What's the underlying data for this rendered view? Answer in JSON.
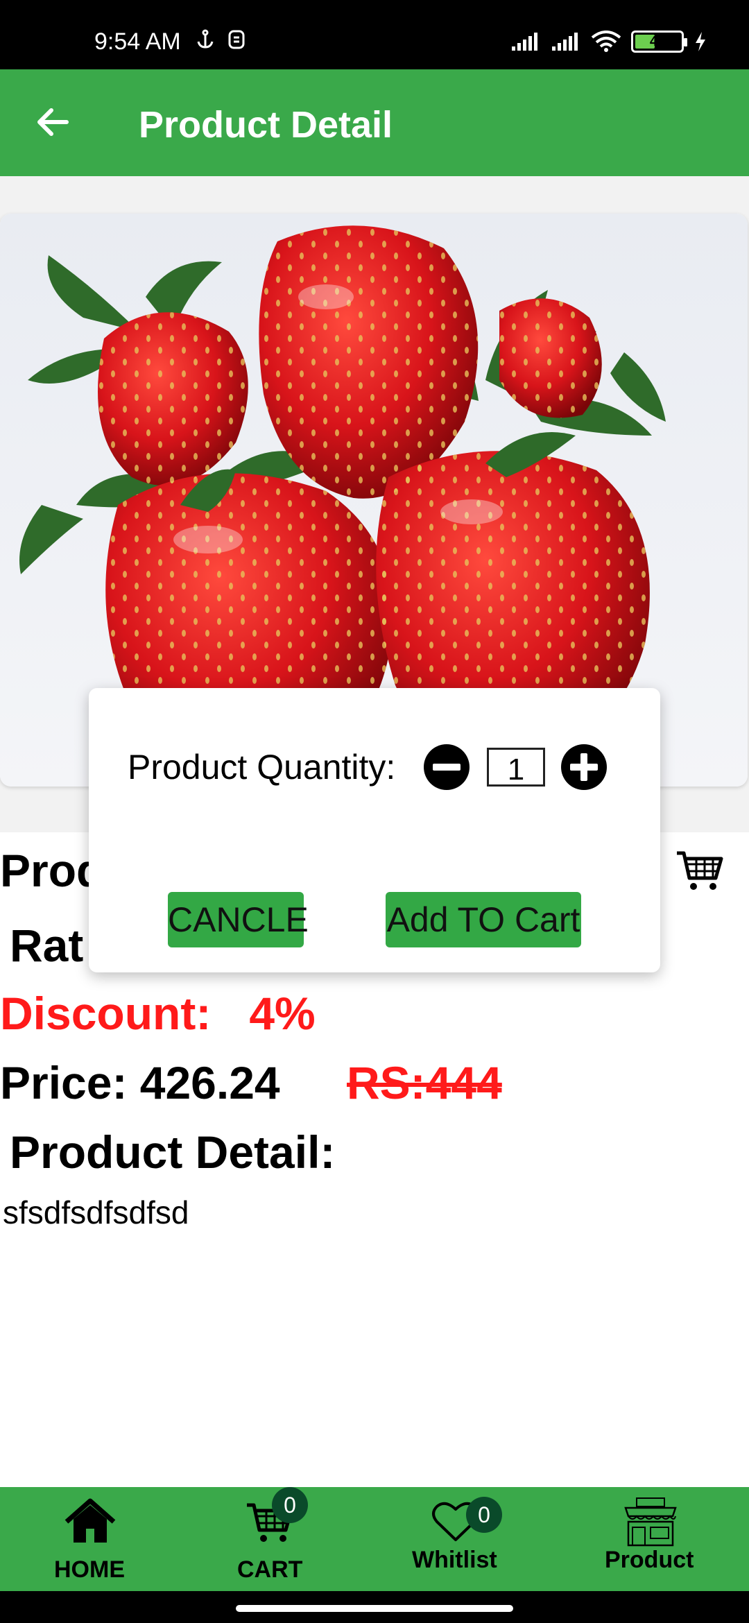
{
  "status_bar": {
    "time": "9:54 AM",
    "battery_level": "44",
    "icons": [
      "anchor-icon",
      "notification-icon",
      "signal-icon",
      "signal-icon",
      "wifi-icon",
      "battery-icon",
      "charging-icon"
    ]
  },
  "app_bar": {
    "title": "Product Detail",
    "back_icon": "arrow-left-icon"
  },
  "product": {
    "name": "Prod",
    "rating_label": "Rat",
    "discount": "Discount:   4%",
    "price": "Price: 426.24",
    "old_price": "RS:444",
    "detail_heading": "Product Detail:",
    "detail_text": "sfsdfsdfsdfsd",
    "image": "strawberries-photo"
  },
  "dialog": {
    "quantity_label": "Product Quantity:",
    "quantity_value": "1",
    "cancel_label": "CANCLE",
    "add_to_cart_label": "Add TO Cart"
  },
  "bottom_nav": {
    "items": [
      {
        "label": "HOME",
        "icon": "home-icon"
      },
      {
        "label": "CART",
        "icon": "cart-icon",
        "badge": "0"
      },
      {
        "label": "Whitlist",
        "icon": "heart-icon",
        "badge": "0"
      },
      {
        "label": "Product",
        "icon": "shop-icon"
      }
    ]
  },
  "colors": {
    "primary_green": "#3aa94a",
    "button_green": "#33a845",
    "discount_red": "#ff1a1a",
    "badge_dark": "#0a4a2a"
  }
}
